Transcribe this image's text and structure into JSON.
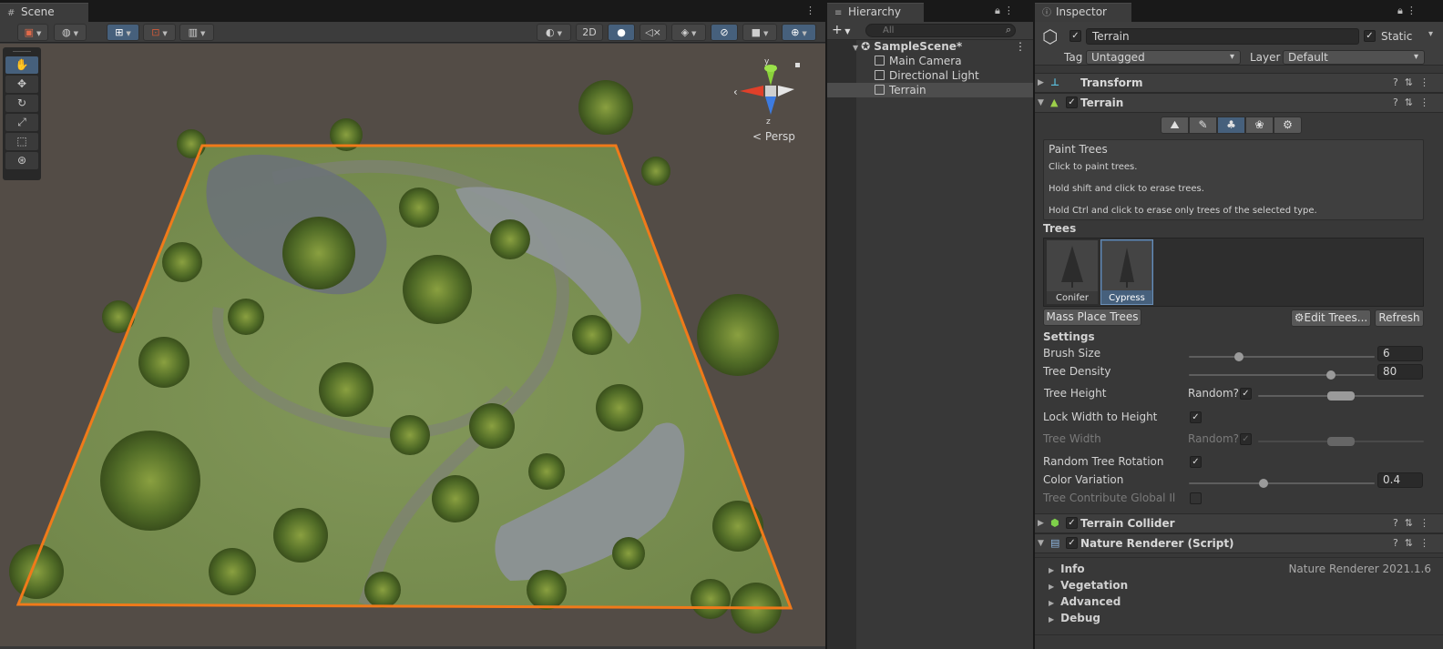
{
  "scene": {
    "tab_title": "Scene",
    "toolbar": {
      "btn_2d": "2D"
    },
    "persp_label": "Persp",
    "axes": {
      "x": "x",
      "y": "y",
      "z": "z"
    }
  },
  "hierarchy": {
    "tab_title": "Hierarchy",
    "search_placeholder": "All",
    "add_label": "+",
    "scene_name": "SampleScene*",
    "items": [
      "Main Camera",
      "Directional Light",
      "Terrain"
    ],
    "selected": "Terrain"
  },
  "inspector": {
    "tab_title": "Inspector",
    "object_name": "Terrain",
    "static_label": "Static",
    "tag_label": "Tag",
    "tag_value": "Untagged",
    "layer_label": "Layer",
    "layer_value": "Default",
    "components": {
      "transform": "Transform",
      "terrain": "Terrain",
      "terrain_collider": "Terrain Collider",
      "nature_renderer": "Nature Renderer (Script)"
    },
    "paint_trees": {
      "title": "Paint Trees",
      "line1": "Click to paint trees.",
      "line2": "Hold shift and click to erase trees.",
      "line3": "Hold Ctrl and click to erase only trees of the selected type."
    },
    "trees_label": "Trees",
    "trees": [
      {
        "name": "Conifer",
        "selected": false
      },
      {
        "name": "Cypress",
        "selected": true
      }
    ],
    "mass_place_label": "Mass Place Trees",
    "edit_trees_label": "Edit Trees...",
    "refresh_label": "Refresh",
    "settings_label": "Settings",
    "settings": {
      "brush_size_label": "Brush Size",
      "brush_size": "6",
      "brush_size_fraction": 0.27,
      "tree_density_label": "Tree Density",
      "tree_density": "80",
      "tree_density_fraction": 0.8,
      "tree_height_label": "Tree Height",
      "random_label": "Random?",
      "lock_width_label": "Lock Width to Height",
      "tree_width_label": "Tree Width",
      "random_rotation_label": "Random Tree Rotation",
      "color_variation_label": "Color Variation",
      "color_variation": "0.4",
      "color_variation_fraction": 0.4,
      "contribute_gi_label": "Tree Contribute Global Illumi"
    },
    "nature_renderer": {
      "sections": [
        "Info",
        "Vegetation",
        "Advanced",
        "Debug"
      ],
      "version": "Nature Renderer 2021.1.6"
    }
  },
  "colors": {
    "selection_blue": "#46607c",
    "terrain_outline": "#f07a1a",
    "panel_bg": "#383838"
  }
}
